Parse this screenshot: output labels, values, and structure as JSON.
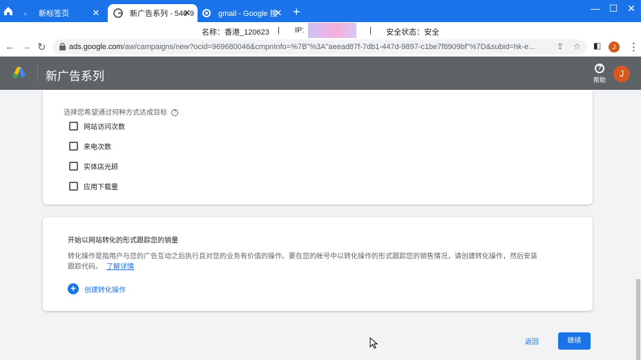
{
  "browser": {
    "tabs": [
      {
        "title": "新标签页",
        "active": false
      },
      {
        "title": "新广告系列 - 546-9",
        "active": true
      },
      {
        "title": "gmail - Google 搜",
        "active": false
      }
    ],
    "new_tab": "+",
    "window_controls": {
      "minimize": "—",
      "maximize": "☐",
      "close": "✕"
    },
    "info_bar": {
      "name": "名称：香港_120623",
      "sep1": "|",
      "ip_label": "IP:",
      "sep2": "|",
      "security": "安全状态：安全"
    },
    "url": {
      "host": "ads.google.com",
      "path": "/aw/campaigns/new?ocid=969680046&cmpnInfo=%7B\"%3A\"aeead87f-7db1-447d-9897-c1be7f8909bf\"%7D&subid=hk-e..."
    },
    "profile_initial": "J"
  },
  "ads": {
    "title": "新广告系列",
    "help_label": "帮助",
    "avatar_initial": "J"
  },
  "goals": {
    "label": "选择您希望通过何种方式达成目标",
    "help": "?",
    "options": [
      {
        "label": "网站访问次数",
        "checked": false
      },
      {
        "label": "来电次数",
        "checked": false
      },
      {
        "label": "实体店光顾",
        "checked": false
      },
      {
        "label": "应用下载量",
        "checked": false
      }
    ]
  },
  "tracking": {
    "title": "开始以网站转化的形式跟踪您的销量",
    "description": "转化操作是指用户与您的广告互动之后执行且对您的业务有价值的操作。要在您的帐号中以转化操作的形式跟踪您的销售情况，请创建转化操作，然后安装跟踪代码。",
    "learn_more": "了解详情",
    "create_label": "创建转化操作"
  },
  "actions": {
    "back": "返回",
    "continue": "继续"
  },
  "colors": {
    "browser_blue": "#1a73e8",
    "ads_header": "#5f6368",
    "accent": "#1a73e8",
    "avatar": "#d6591f"
  }
}
